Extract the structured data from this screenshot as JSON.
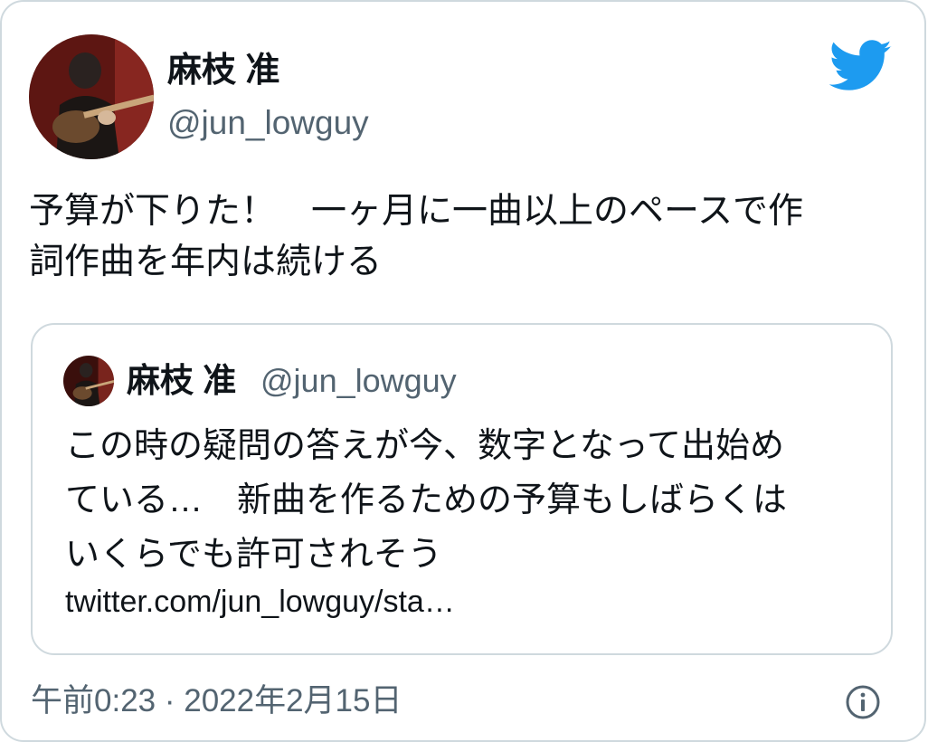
{
  "tweet": {
    "author": {
      "display_name": "麻枝 准",
      "handle": "@jun_lowguy",
      "avatar_icon": "guitarist-avatar"
    },
    "brand_icon": "twitter-bird-icon",
    "brand_color": "#1d9bf0",
    "text": "予算が下りた！　一ヶ月に一曲以上のペースで作\n詞作曲を年内は続ける",
    "quoted": {
      "display_name": "麻枝 准",
      "handle": "@jun_lowguy",
      "text": "この時の疑問の答えが今、数字となって出始め\nている…　新曲を作るための予算もしばらくは\nいくらでも許可されそう",
      "link": "twitter.com/jun_lowguy/sta…"
    },
    "timestamp": "午前0:23 · 2022年2月15日",
    "info_icon": "info-icon"
  }
}
